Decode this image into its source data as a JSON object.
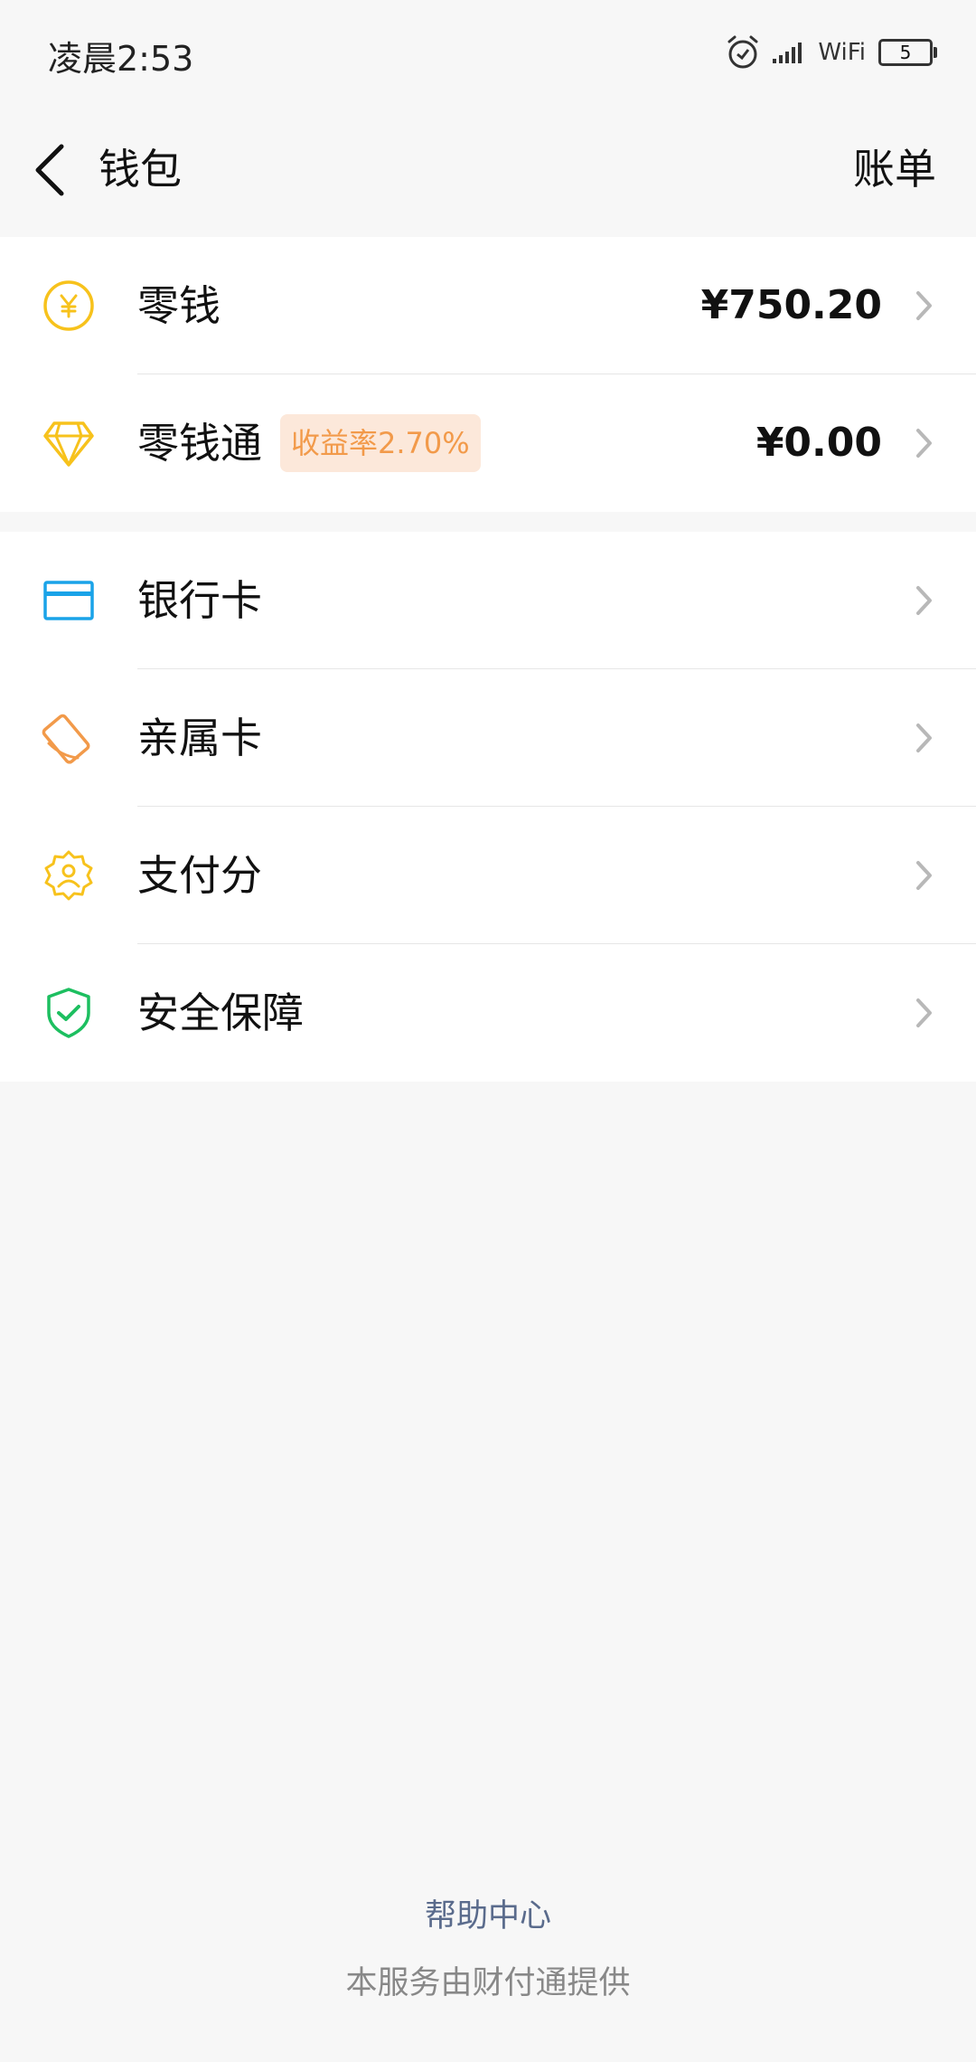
{
  "status_bar": {
    "time": "凌晨2:53",
    "wifi": "WiFi",
    "battery": "5",
    "icons": [
      "alarm-icon",
      "signal-icon",
      "wifi-label",
      "battery-icon"
    ]
  },
  "nav": {
    "title": "钱包",
    "action": "账单",
    "back_icon": "back-arrow-icon"
  },
  "balance_group": [
    {
      "label": "零钱",
      "amount": "¥750.20",
      "icon": "yuan-coin-icon",
      "icon_color": "#f7c21c"
    },
    {
      "label": "零钱通",
      "badge": "收益率2.70%",
      "amount": "¥0.00",
      "icon": "diamond-icon",
      "icon_color": "#f7c21c"
    }
  ],
  "service_group": [
    {
      "label": "银行卡",
      "icon": "bank-card-icon",
      "icon_color": "#1aa3e8"
    },
    {
      "label": "亲属卡",
      "icon": "family-card-icon",
      "icon_color": "#f29a4a"
    },
    {
      "label": "支付分",
      "icon": "pay-score-icon",
      "icon_color": "#f7c21c"
    },
    {
      "label": "安全保障",
      "icon": "security-shield-icon",
      "icon_color": "#1dbf60"
    }
  ],
  "footer": {
    "help": "帮助中心",
    "provider": "本服务由财付通提供"
  },
  "colors": {
    "background": "#f7f7f7",
    "badge_bg": "#fce8da",
    "badge_text": "#f29a4a",
    "link": "#5a6b8c"
  }
}
